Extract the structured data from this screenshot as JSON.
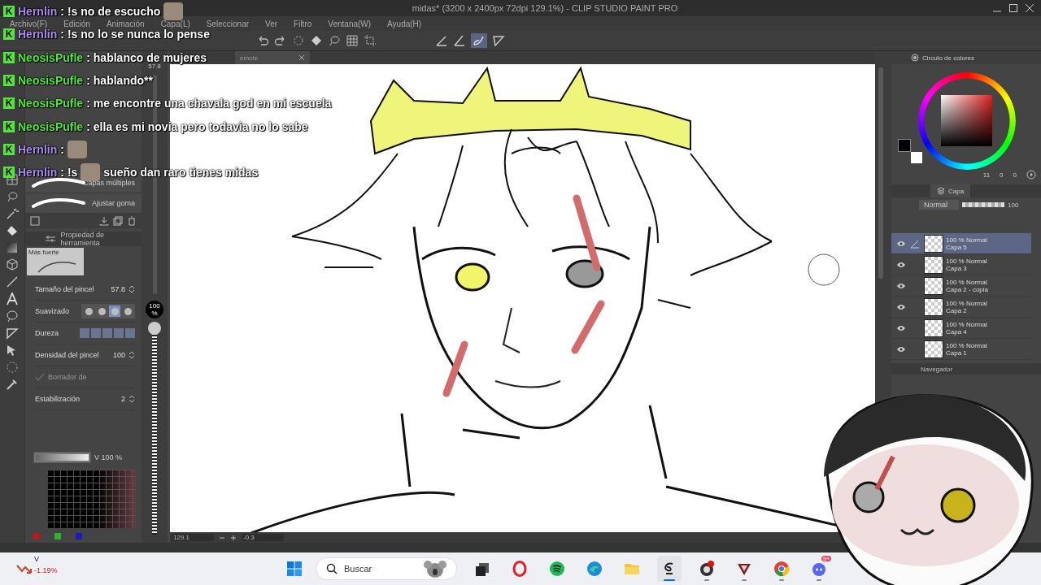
{
  "window": {
    "title": "midas* (3200 x 2400px 72dpi 129.1%)  - CLIP STUDIO PAINT PRO"
  },
  "menu": [
    "Archivo(F)",
    "Edición",
    "Animación",
    "Capa(L)",
    "Seleccionar",
    "Ver",
    "Filtro",
    "Ventana(W)",
    "Ayuda(H)"
  ],
  "canvas_tabs": [
    {
      "label": "emote",
      "selected": false
    }
  ],
  "brush_size_readout": "57.8",
  "sub_tools": [
    "Capas múltiples",
    "Ajustar goma"
  ],
  "tool_property": {
    "title": "Propiedad de herramienta",
    "preset": "Más fuerte",
    "rows": [
      {
        "kind": "number",
        "label": "Tamaño del pincel",
        "value": "57.8"
      },
      {
        "kind": "options",
        "label": "Suavizado",
        "options": [
          {
            "selected": false
          },
          {
            "selected": false
          },
          {
            "selected": true
          },
          {
            "selected": false
          }
        ]
      },
      {
        "kind": "swatches",
        "label": "Dureza"
      },
      {
        "kind": "number",
        "label": "Densidad del pincel",
        "value": "100"
      },
      {
        "kind": "check",
        "label": "Borrador de",
        "checked": true,
        "disabled": true
      },
      {
        "kind": "number",
        "label": "Estabilización",
        "value": "2"
      }
    ]
  },
  "color_set": {
    "value_label": "V 100 %",
    "level": 1
  },
  "opacity": {
    "badge": "100 %",
    "level": 1
  },
  "color_wheel": {
    "title": "Circulo de colores",
    "readouts": [
      "11",
      "0",
      "0"
    ]
  },
  "layers_panel": {
    "tab": "Capa",
    "blend_mode": "Normal",
    "opacity": "100",
    "layers": [
      {
        "mode": "100 % Normal",
        "name": "Capa 5",
        "selected": true,
        "visible": true
      },
      {
        "mode": "100 % Normal",
        "name": "Capa 3",
        "selected": false,
        "visible": true
      },
      {
        "mode": "100 % Normal",
        "name": "Capa 2 - copia",
        "selected": false,
        "visible": true
      },
      {
        "mode": "100 % Normal",
        "name": "Capa 2",
        "selected": false,
        "visible": true
      },
      {
        "mode": "100 % Normal",
        "name": "Capa 4",
        "selected": false,
        "visible": true
      },
      {
        "mode": "100 % Normal",
        "name": "Capa 1",
        "selected": false,
        "visible": true
      }
    ]
  },
  "navigator": {
    "tab": "Navegador"
  },
  "status_bar": {
    "zoom": "129.1",
    "angle": "-0.3"
  },
  "chat": [
    {
      "badge": "K",
      "user": "Hernlin",
      "color": "#a98ce8",
      "sep": ":",
      "parts": [
        {
          "kind": "text",
          "text": "!s no de escucho"
        },
        {
          "kind": "emote"
        }
      ]
    },
    {
      "badge": "K",
      "user": "Hernlin",
      "color": "#a98ce8",
      "sep": ":",
      "parts": [
        {
          "kind": "text",
          "text": "!s no lo se nunca lo pense"
        }
      ]
    },
    {
      "badge": "K",
      "user": "NeosisPufle",
      "color": "#53e63a",
      "sep": ":",
      "parts": [
        {
          "kind": "text",
          "text": "hablanco de mujeres"
        }
      ]
    },
    {
      "badge": "K",
      "user": "NeosisPufle",
      "color": "#53e63a",
      "sep": ":",
      "parts": [
        {
          "kind": "text",
          "text": "hablando**"
        }
      ]
    },
    {
      "badge": "K",
      "user": "NeosisPufle",
      "color": "#53e63a",
      "sep": ":",
      "parts": [
        {
          "kind": "text",
          "text": "me encontre una chavala god en mi escuela"
        }
      ]
    },
    {
      "badge": "K",
      "user": "NeosisPufle",
      "color": "#53e63a",
      "sep": ":",
      "parts": [
        {
          "kind": "text",
          "text": "ella es mi novia pero todavia no lo sabe"
        }
      ]
    },
    {
      "badge": "K",
      "user": "Hernlin",
      "color": "#a98ce8",
      "sep": ":",
      "parts": [
        {
          "kind": "emote"
        }
      ]
    },
    {
      "badge": "K",
      "user": "Hernlin",
      "color": "#a98ce8",
      "sep": ":",
      "parts": [
        {
          "kind": "text",
          "text": "!s"
        },
        {
          "kind": "emote"
        },
        {
          "kind": "text",
          "text": "sueño dan raro tienes midas"
        }
      ]
    }
  ],
  "taskbar": {
    "stock": {
      "symbol": "V",
      "change": "-1.19%"
    },
    "search_placeholder": "Buscar",
    "apps": [
      {
        "kind": "files",
        "running": false,
        "selected": false
      },
      {
        "kind": "opera",
        "running": false,
        "selected": false
      },
      {
        "kind": "spotify",
        "running": false,
        "selected": false
      },
      {
        "kind": "edge",
        "running": false,
        "selected": false
      },
      {
        "kind": "folder",
        "running": false,
        "selected": false
      },
      {
        "kind": "clipstudio",
        "running": true,
        "selected": true
      },
      {
        "kind": "obs",
        "running": true,
        "selected": false
      },
      {
        "kind": "vapp",
        "running": true,
        "selected": false
      },
      {
        "kind": "chrome",
        "running": true,
        "selected": false
      },
      {
        "kind": "discord",
        "running": true,
        "selected": false,
        "badge": "9+"
      }
    ]
  }
}
